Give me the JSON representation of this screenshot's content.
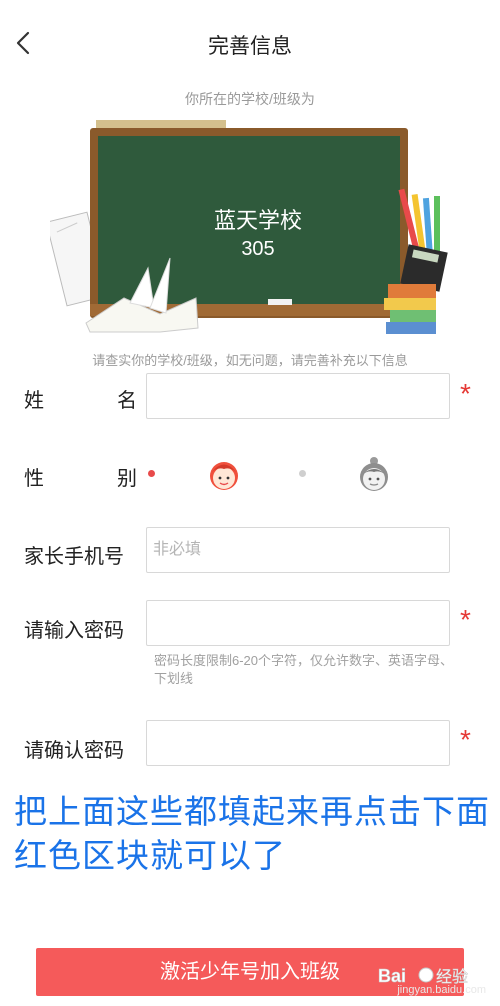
{
  "header": {
    "back_icon": "chevron-left-icon",
    "title": "完善信息"
  },
  "subtitle": "你所在的学校/班级为",
  "board": {
    "school": "蓝天学校",
    "class": "305"
  },
  "notice": "请查实你的学校/班级，如无问题，请完善补充以下信息",
  "form": {
    "name_label_1": "姓",
    "name_label_2": "名",
    "name_value": "",
    "gender_label_1": "性",
    "gender_label_2": "别",
    "gender_options": [
      {
        "icon": "boy-avatar-icon",
        "selected": true
      },
      {
        "icon": "girl-avatar-icon",
        "selected": false
      }
    ],
    "parent_phone_label": "家长手机号",
    "parent_phone_placeholder": "非必填",
    "password_label": "请输入密码",
    "password_hint": "密码长度限制6-20个字符，仅允许数字、英语字母、下划线",
    "confirm_password_label": "请确认密码",
    "required_mark": "*"
  },
  "annotation": "把上面这些都填起来再点击下面红色区块就可以了",
  "submit_label": "激活少年号加入班级",
  "watermark": {
    "text": "jingyan.baidu.com"
  },
  "colors": {
    "accent": "#f55a5a",
    "required": "#e53935",
    "annotation": "#1a73e8",
    "board_green": "#2f5a3c"
  }
}
